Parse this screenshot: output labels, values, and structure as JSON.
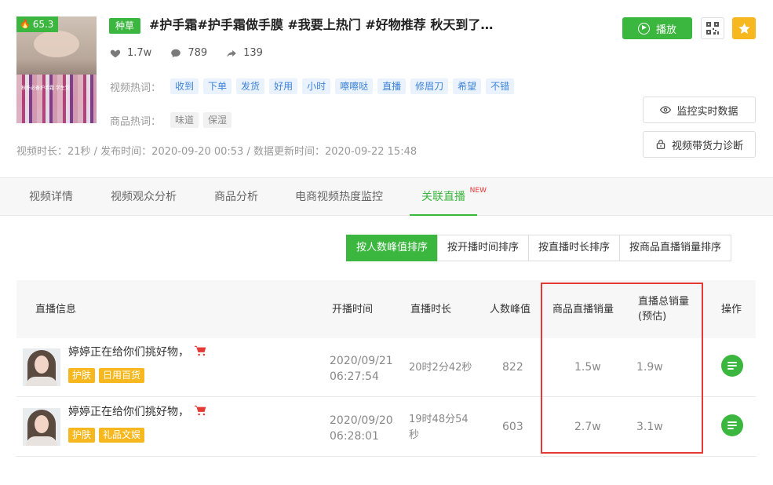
{
  "video": {
    "score": "65.3",
    "category_tag": "种草",
    "title": "#护手霜#护手霜做手膜 #我要上热门 #好物推荐 秋天到了，...",
    "thumbnail_caption": "秋冬必备护手霜 学生党",
    "likes": "1.7w",
    "comments": "789",
    "shares": "139",
    "hot_words_label": "视频热词：",
    "hot_words": [
      "收到",
      "下单",
      "发货",
      "好用",
      "小时",
      "嚓嚓哒",
      "直播",
      "修眉刀",
      "希望",
      "不错"
    ],
    "product_words_label": "商品热词：",
    "product_words": [
      "味道",
      "保湿"
    ],
    "meta": "视频时长：21秒 / 发布时间：2020-09-20 00:53 / 数据更新时间：2020-09-22 15:48"
  },
  "actions": {
    "play_label": "播放",
    "monitor_label": "监控实时数据",
    "diagnose_label": "视频带货力诊断"
  },
  "tabs": [
    {
      "label": "视频详情"
    },
    {
      "label": "视频观众分析"
    },
    {
      "label": "商品分析"
    },
    {
      "label": "电商视频热度监控"
    },
    {
      "label": "关联直播",
      "badge": "NEW"
    }
  ],
  "sort_buttons": [
    "按人数峰值排序",
    "按开播时间排序",
    "按直播时长排序",
    "按商品直播销量排序"
  ],
  "table": {
    "headers": {
      "info": "直播信息",
      "start": "开播时间",
      "duration": "直播时长",
      "peak": "人数峰值",
      "product_sales": "商品直播销量",
      "total_sales_1": "直播总销量",
      "total_sales_2": "(预估)",
      "op": "操作"
    },
    "rows": [
      {
        "name": "婷婷正在给你们挑好物，",
        "tags": [
          "护肤",
          "日用百货"
        ],
        "start_date": "2020/09/21",
        "start_time": "06:27:54",
        "duration_1": "20时2分42秒",
        "duration_2": "",
        "peak": "822",
        "product_sales": "1.5w",
        "total_sales": "1.9w"
      },
      {
        "name": "婷婷正在给你们挑好物，",
        "tags": [
          "护肤",
          "礼品文娱"
        ],
        "start_date": "2020/09/20",
        "start_time": "06:28:01",
        "duration_1": "19时48分54",
        "duration_2": "秒",
        "peak": "603",
        "product_sales": "2.7w",
        "total_sales": "3.1w"
      }
    ]
  },
  "colors": {
    "accent_green": "#3bb63e",
    "tag_orange": "#f7b71f",
    "highlight_red": "#e53935",
    "keyword_blue": "#3f83d8"
  }
}
